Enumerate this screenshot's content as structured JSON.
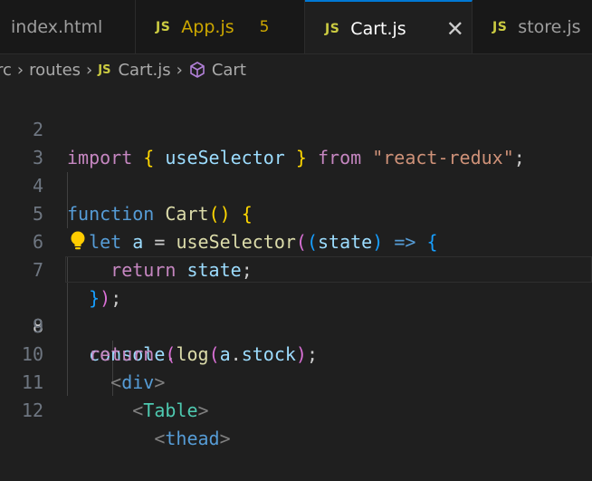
{
  "tabs": [
    {
      "label": "index.html",
      "kind": "html"
    },
    {
      "label": "App.js",
      "badge": "JS",
      "problems": "5"
    },
    {
      "label": "Cart.js",
      "badge": "JS",
      "close": "✕"
    },
    {
      "label": "store.js",
      "badge": "JS"
    }
  ],
  "breadcrumb": {
    "root": "rc",
    "folder": "routes",
    "file_badge": "JS",
    "file": "Cart.js",
    "symbol": "Cart",
    "sep": "›"
  },
  "editor": {
    "current_line": "8",
    "line_numbers": [
      "2",
      "3",
      "4",
      "5",
      "6",
      "7",
      "8",
      "9",
      "10",
      "11",
      "12"
    ]
  },
  "colors": {
    "accent": "#0078d4",
    "js_badge": "#cbcb41",
    "warning": "#cca700"
  }
}
